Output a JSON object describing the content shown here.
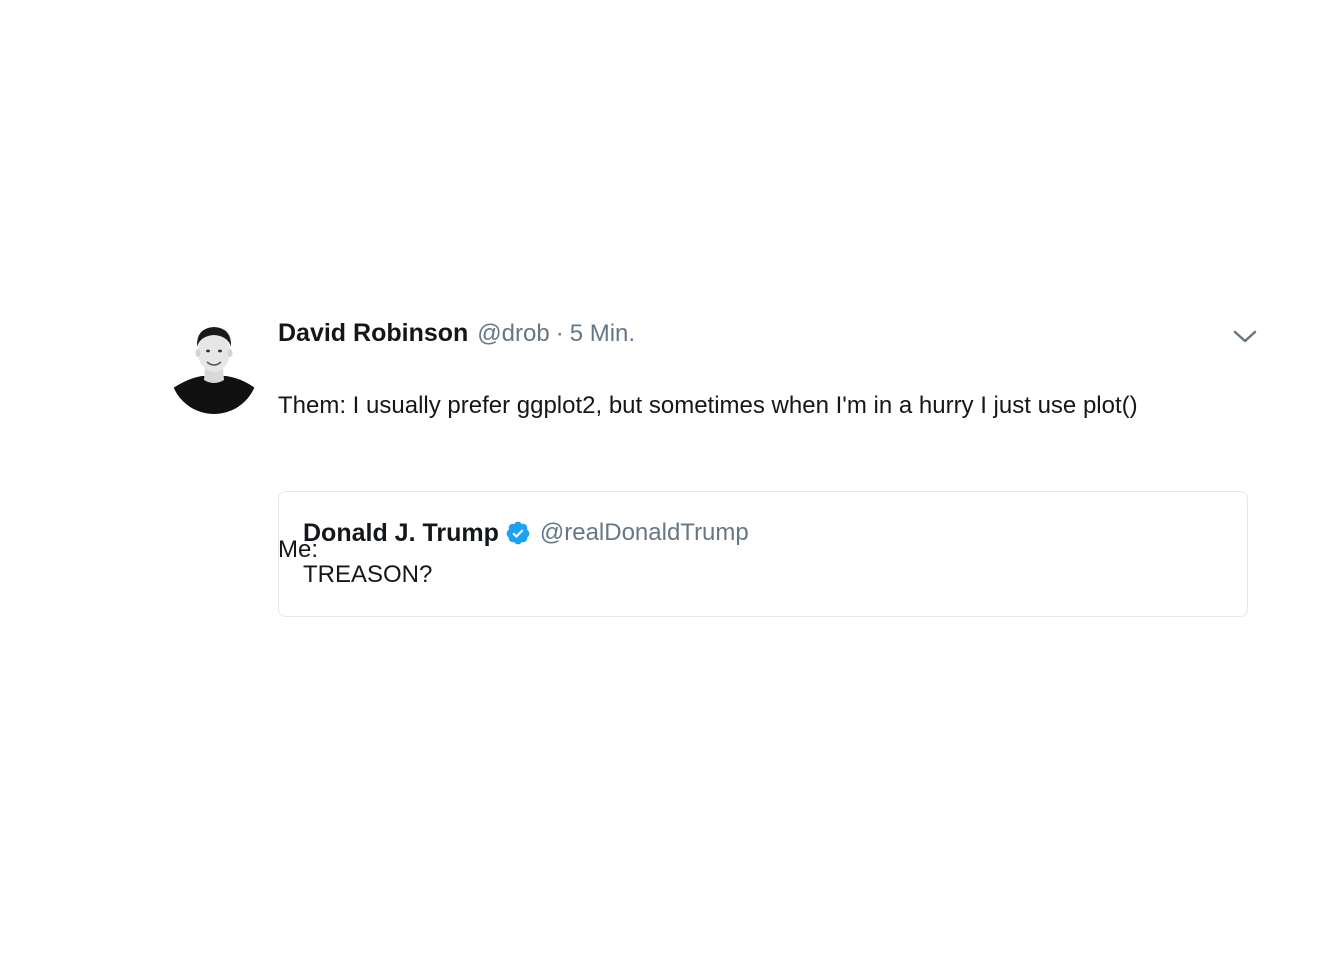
{
  "tweet": {
    "author_name": "David Robinson",
    "author_handle": "@drob",
    "separator": "·",
    "timestamp": "5 Min.",
    "text_line1": "Them: I usually prefer ggplot2, but sometimes when I'm in a hurry I just use plot()",
    "text_line2": "",
    "text_line3": "Me:"
  },
  "quoted_tweet": {
    "author_name": "Donald J. Trump",
    "author_handle": "@realDonaldTrump",
    "text": "TREASON?",
    "verified_color": "#1da1f2"
  },
  "icons": {
    "avatar": "avatar",
    "caret": "chevron-down-icon",
    "verified": "verified-badge-icon"
  }
}
